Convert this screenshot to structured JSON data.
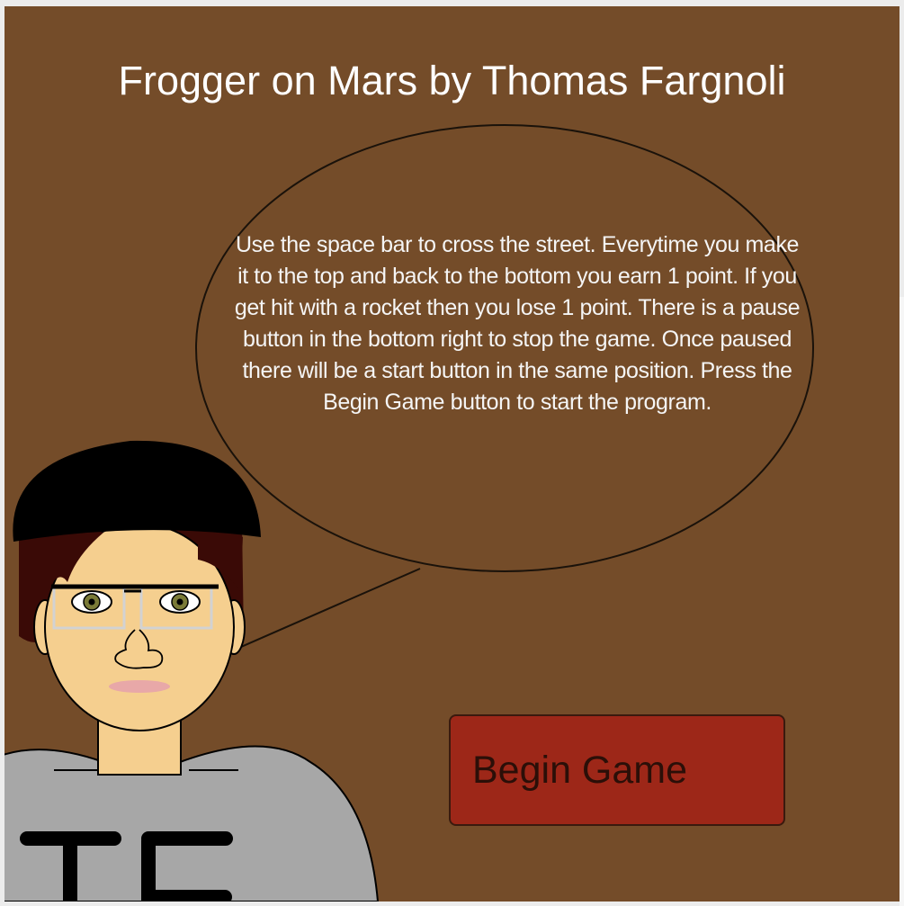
{
  "title": "Frogger on Mars by Thomas Fargnoli",
  "speech_bubble": {
    "text": "Use the space bar to cross the street. Everytime you make it to the top and back to the bottom you earn 1 point. If you get hit with a rocket then you lose 1 point. There is a pause button in the bottom right to stop the game. Once paused there will be a start button in the same position. Press the Begin Game button to start the program."
  },
  "begin_button": {
    "label": "Begin Game"
  },
  "character": {
    "shirt_letters": "TF"
  },
  "colors": {
    "background": "#744c29",
    "button": "#9d2718",
    "hair": "#3a0a06",
    "hat": "#000000",
    "skin": "#f5cf8f",
    "shirt": "#a7a7a7"
  }
}
